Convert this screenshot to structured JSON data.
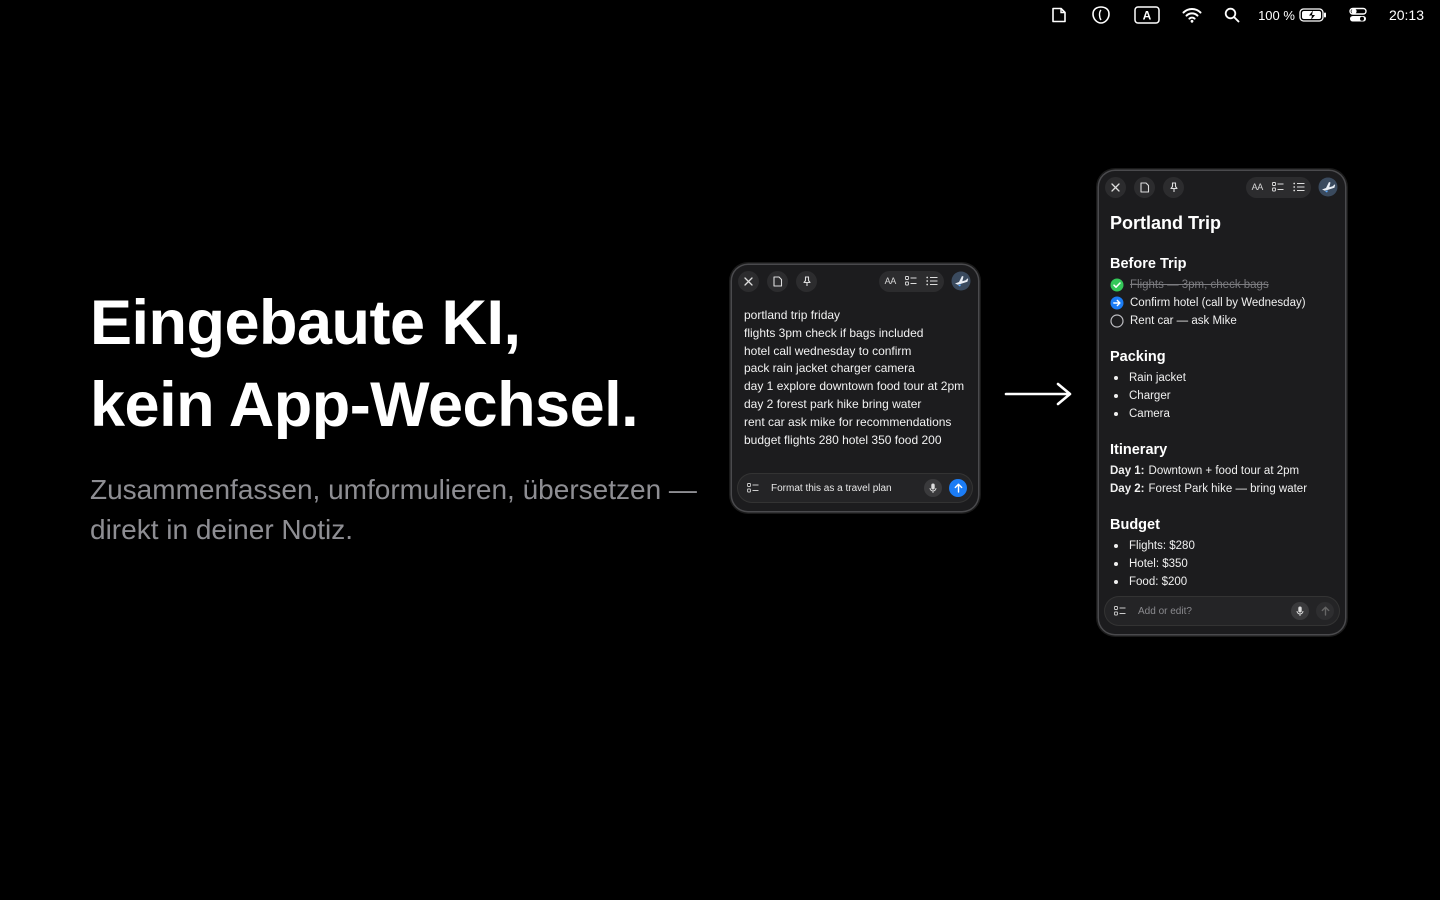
{
  "menubar": {
    "battery_percent_label": "100 %",
    "clock": "20:13",
    "icons": [
      "note-icon",
      "app-icon",
      "input-source-icon",
      "wifi-icon",
      "search-icon",
      "battery-charging-icon",
      "control-center-icon"
    ],
    "input_source_letter": "A"
  },
  "hero": {
    "headline_line1": "Eingebaute KI,",
    "headline_line2": "kein App-Wechsel.",
    "subline_line1": "Zusammenfassen, umformulieren, übersetzen —",
    "subline_line2": "direkt in deiner Notiz."
  },
  "note_raw": {
    "toolbar_aa": "AA",
    "lines": [
      "portland trip friday",
      "flights 3pm check if bags included",
      "hotel call wednesday to confirm",
      "pack rain jacket charger camera",
      "day 1 explore downtown food tour at 2pm",
      "day 2 forest park hike bring water",
      "rent car ask mike for recommendations",
      "budget flights 280 hotel 350 food 200"
    ],
    "prompt_text": "Format this as a travel plan"
  },
  "note_formatted": {
    "toolbar_aa": "AA",
    "title": "Portland Trip",
    "before_trip": {
      "heading": "Before Trip",
      "items": [
        {
          "text": "Flights — 3pm, check bags",
          "state": "done"
        },
        {
          "text": "Confirm hotel (call by Wednesday)",
          "state": "active"
        },
        {
          "text": "Rent car — ask Mike",
          "state": "open"
        }
      ]
    },
    "packing": {
      "heading": "Packing",
      "items": [
        "Rain jacket",
        "Charger",
        "Camera"
      ]
    },
    "itinerary": {
      "heading": "Itinerary",
      "items": [
        {
          "label": "Day 1:",
          "text": "Downtown + food tour at 2pm"
        },
        {
          "label": "Day 2:",
          "text": "Forest Park hike — bring water"
        }
      ]
    },
    "budget": {
      "heading": "Budget",
      "items": [
        "Flights: $280",
        "Hotel: $350",
        "Food: $200"
      ]
    },
    "prompt_placeholder": "Add or edit?"
  },
  "colors": {
    "background": "#000000",
    "note_bg": "#1c1c1e",
    "accent_blue": "#1b7cf5",
    "done_green": "#34c759",
    "muted_text": "#8e8e93"
  }
}
